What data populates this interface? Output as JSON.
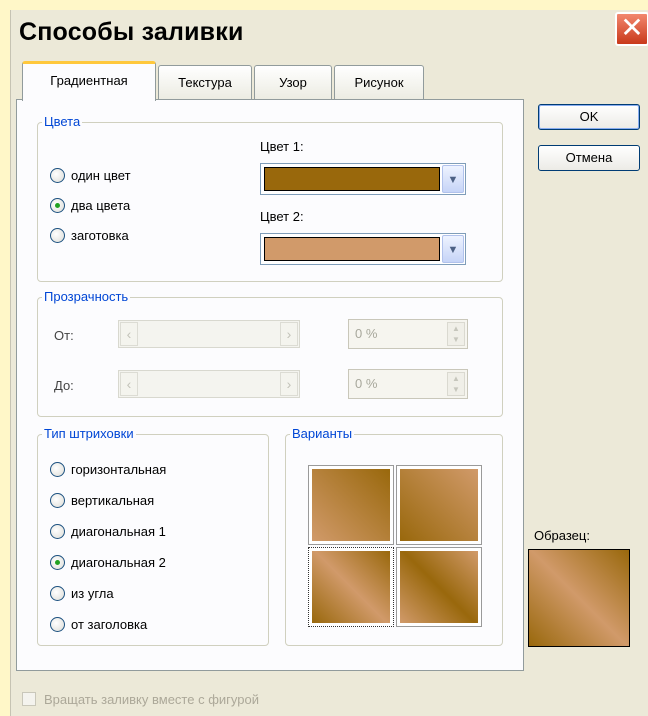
{
  "window": {
    "title": "Способы заливки"
  },
  "tabs": [
    {
      "label": "Градиентная",
      "active": true
    },
    {
      "label": "Текстура",
      "active": false
    },
    {
      "label": "Узор",
      "active": false
    },
    {
      "label": "Рисунок",
      "active": false
    }
  ],
  "buttons": {
    "ok": "OK",
    "cancel": "Отмена"
  },
  "colors_group": {
    "label": "Цвета",
    "options": [
      {
        "label": "один цвет",
        "checked": false
      },
      {
        "label": "два цвета",
        "checked": true
      },
      {
        "label": "заготовка",
        "checked": false
      }
    ],
    "color1_label": "Цвет 1:",
    "color1_value": "#99680c",
    "color2_label": "Цвет 2:",
    "color2_value": "#d19a6a"
  },
  "transparency": {
    "label": "Прозрачность",
    "from_label": "От:",
    "from_value": "0 %",
    "to_label": "До:",
    "to_value": "0 %"
  },
  "shading": {
    "label": "Тип штриховки",
    "options": [
      {
        "label": "горизонтальная",
        "checked": false
      },
      {
        "label": "вертикальная",
        "checked": false
      },
      {
        "label": "диагональная 1",
        "checked": false
      },
      {
        "label": "диагональная 2",
        "checked": true
      },
      {
        "label": "из угла",
        "checked": false
      },
      {
        "label": "от заголовка",
        "checked": false
      }
    ]
  },
  "variants": {
    "label": "Варианты"
  },
  "sample": {
    "label": "Образец:"
  },
  "rotate_checkbox": {
    "label": "Вращать заливку вместе с фигурой",
    "checked": false,
    "enabled": false
  }
}
